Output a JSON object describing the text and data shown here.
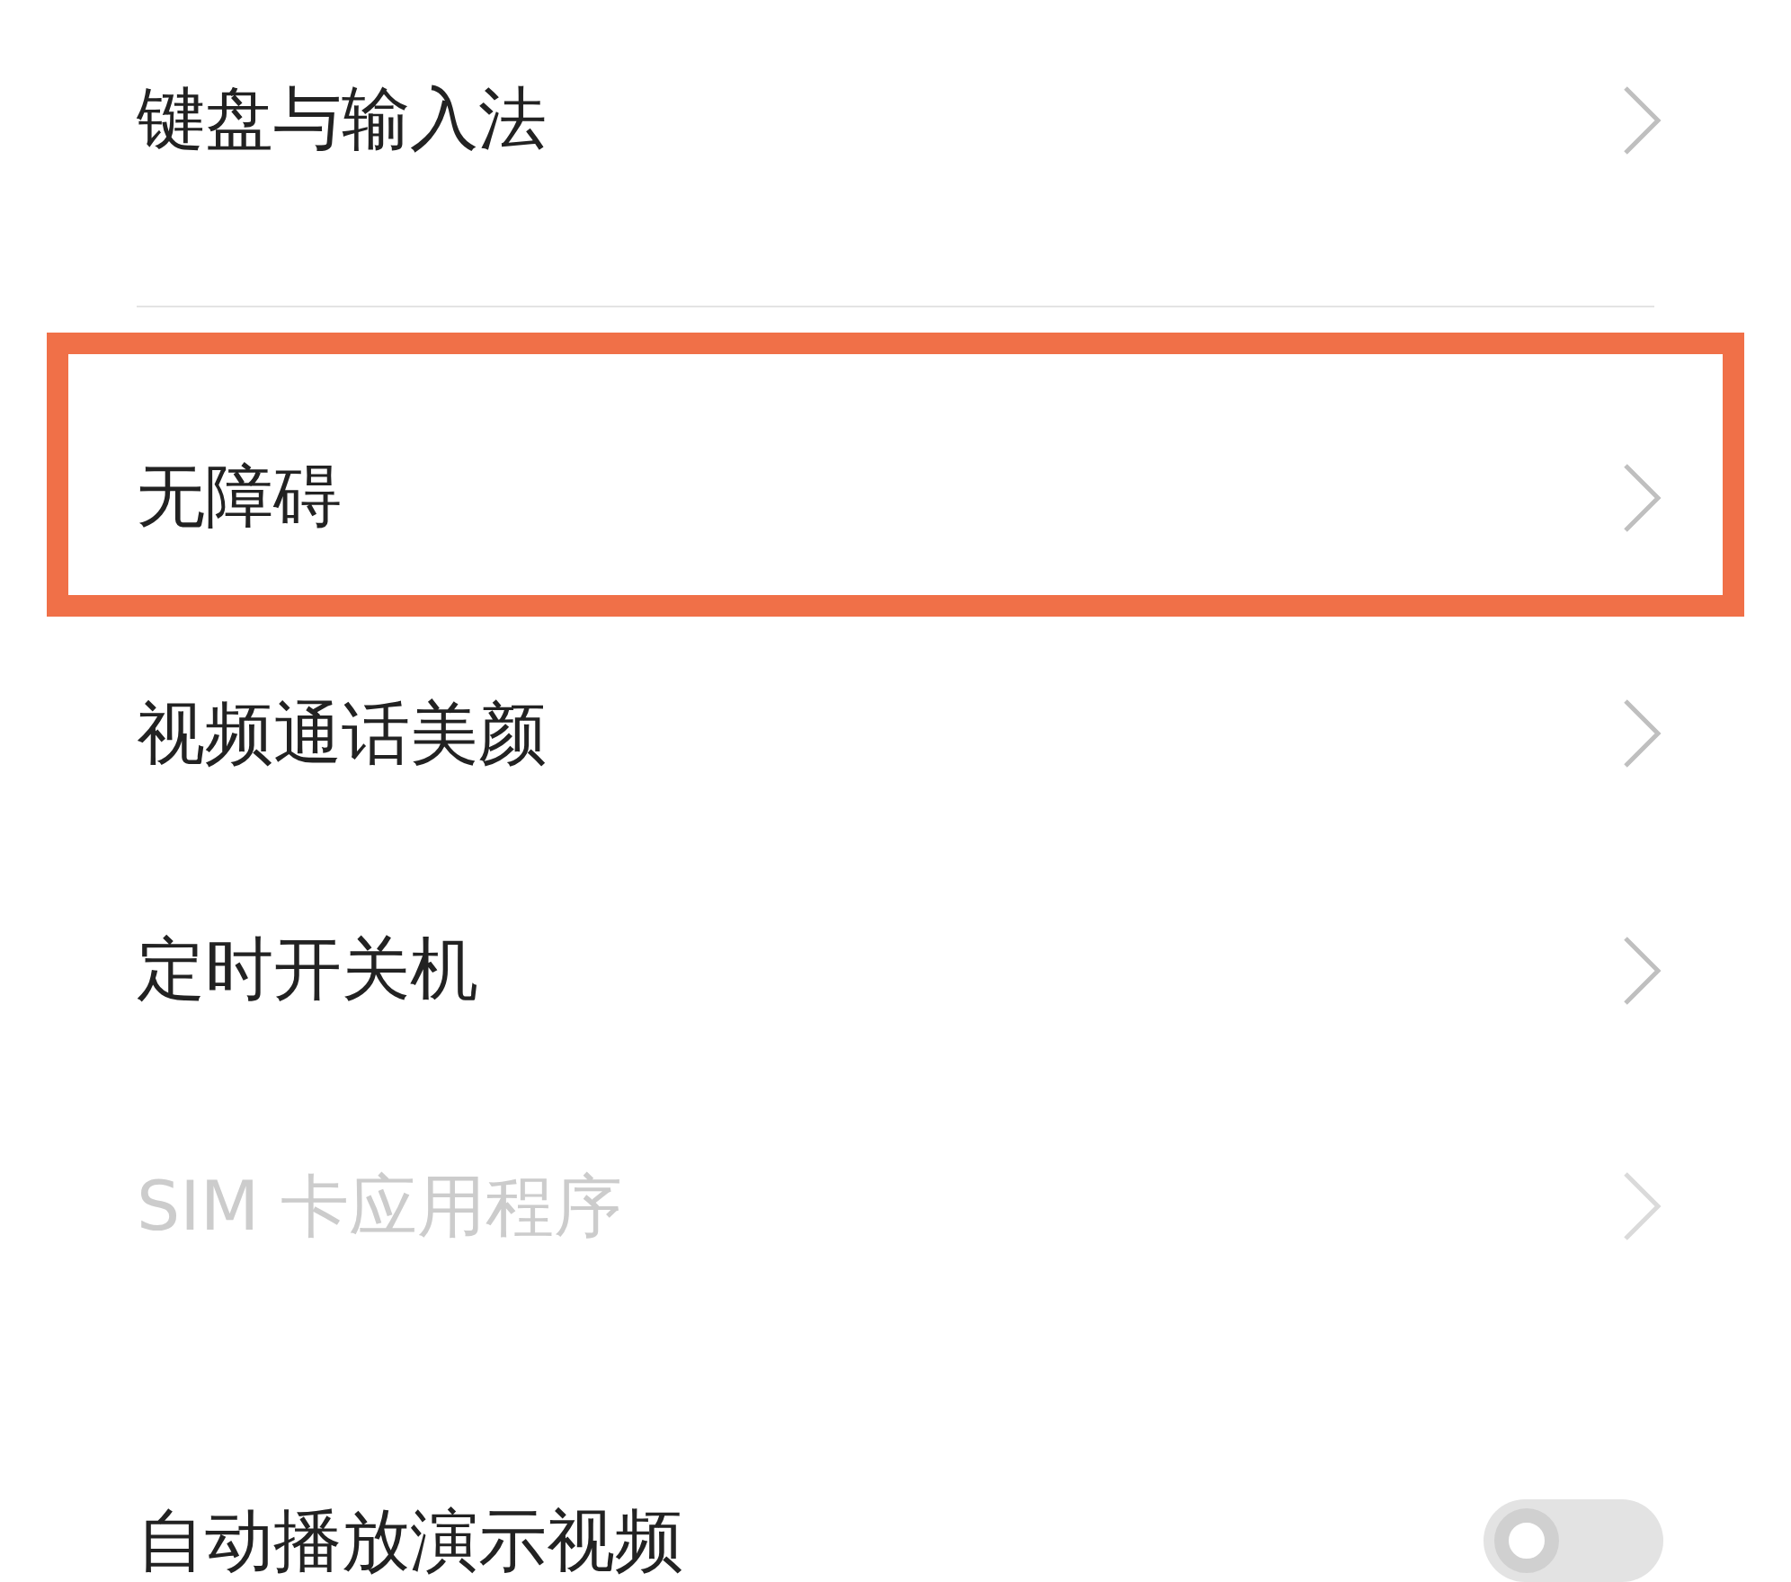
{
  "groups": [
    {
      "items": [
        {
          "kind": "link",
          "label": "键盘与输入法",
          "disabled": false,
          "highlighted": false
        }
      ]
    },
    {
      "items": [
        {
          "kind": "link",
          "label": "无障碍",
          "disabled": false,
          "highlighted": true
        },
        {
          "kind": "link",
          "label": "视频通话美颜",
          "disabled": false,
          "highlighted": false
        },
        {
          "kind": "link",
          "label": "定时开关机",
          "disabled": false,
          "highlighted": false
        },
        {
          "kind": "link",
          "label": "SIM 卡应用程序",
          "disabled": true,
          "highlighted": false
        },
        {
          "kind": "toggle",
          "label": "自动播放演示视频",
          "disabled": false,
          "highlighted": false,
          "on": false
        }
      ]
    }
  ]
}
